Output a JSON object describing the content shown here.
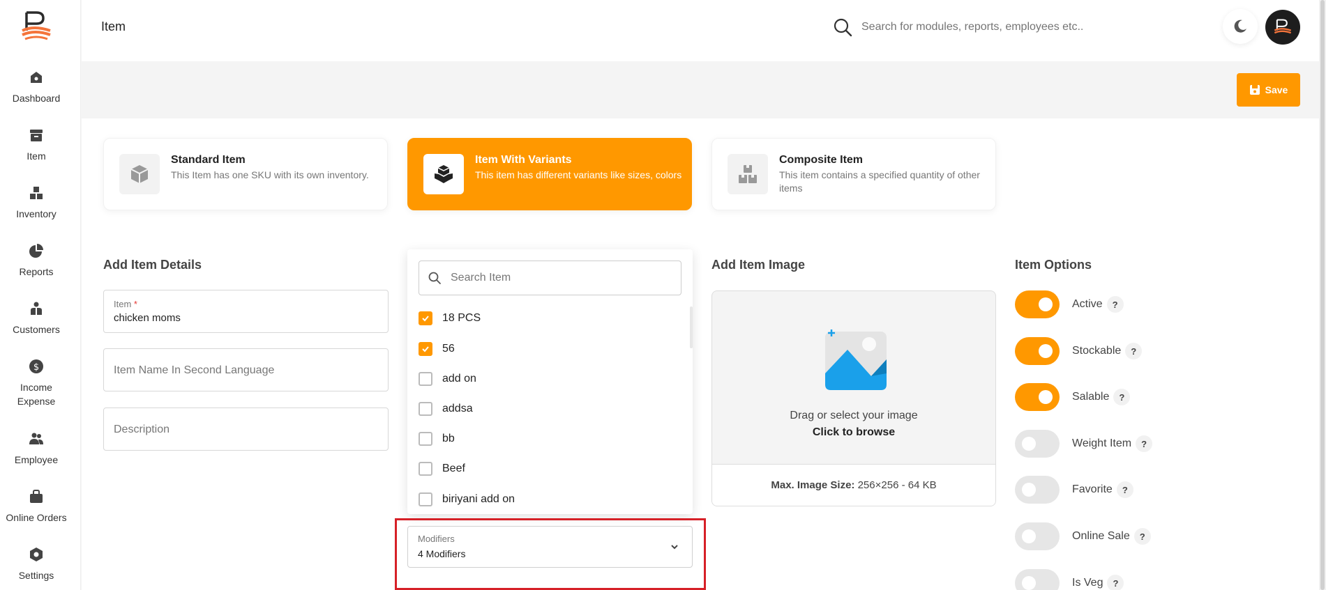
{
  "header": {
    "title": "Item",
    "search_placeholder": "Search for modules, reports, employees etc.."
  },
  "sidebar": {
    "items": [
      {
        "label": "Dashboard",
        "icon": "dashboard-icon"
      },
      {
        "label": "Item",
        "icon": "item-icon"
      },
      {
        "label": "Inventory",
        "icon": "inventory-icon"
      },
      {
        "label": "Reports",
        "icon": "reports-icon"
      },
      {
        "label": "Customers",
        "icon": "customers-icon"
      },
      {
        "label": "Income Expense",
        "icon": "dollar-icon"
      },
      {
        "label": "Employee",
        "icon": "employee-icon"
      },
      {
        "label": "Online Orders",
        "icon": "bag-icon"
      },
      {
        "label": "Settings",
        "icon": "settings-icon"
      }
    ]
  },
  "toolbar": {
    "save_label": "Save"
  },
  "item_types": [
    {
      "title": "Standard Item",
      "desc": "This Item has one SKU with its own inventory.",
      "active": false
    },
    {
      "title": "Item With Variants",
      "desc": "This item has different variants like sizes, colors",
      "active": true
    },
    {
      "title": "Composite Item",
      "desc": "This item contains a specified quantity of other items",
      "active": false
    }
  ],
  "details": {
    "title": "Add Item Details",
    "item_label": "Item",
    "item_required": "*",
    "item_value": "chicken moms",
    "second_lang_placeholder": "Item Name In Second Language",
    "description_placeholder": "Description"
  },
  "modifier_dropdown": {
    "search_placeholder": "Search Item",
    "options": [
      {
        "label": "18 PCS",
        "checked": true
      },
      {
        "label": "56",
        "checked": true
      },
      {
        "label": "add on",
        "checked": false
      },
      {
        "label": "addsa",
        "checked": false
      },
      {
        "label": "bb",
        "checked": false
      },
      {
        "label": "Beef",
        "checked": false
      },
      {
        "label": "biriyani add on",
        "checked": false
      }
    ],
    "field_label": "Modifiers",
    "field_value": "4 Modifiers"
  },
  "image": {
    "title": "Add Item Image",
    "line1": "Drag or select your image",
    "line2": "Click to browse",
    "max_label": "Max. Image Size:",
    "max_value": "256×256 - 64 KB"
  },
  "options": {
    "title": "Item Options",
    "items": [
      {
        "label": "Active",
        "on": true
      },
      {
        "label": "Stockable",
        "on": true
      },
      {
        "label": "Salable",
        "on": true
      },
      {
        "label": "Weight Item",
        "on": false
      },
      {
        "label": "Favorite",
        "on": false
      },
      {
        "label": "Online Sale",
        "on": false
      },
      {
        "label": "Is Veg",
        "on": false
      }
    ],
    "help_glyph": "?"
  },
  "colors": {
    "accent": "#ff9800",
    "highlight": "#d62027"
  }
}
